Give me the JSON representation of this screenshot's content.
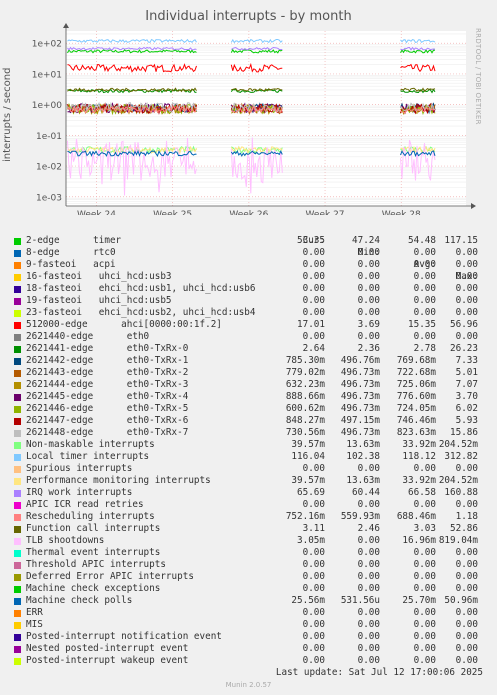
{
  "title": "Individual interrupts - by month",
  "side_credit": "RRDTOOL / TOBI OETIKER",
  "last_update": "Last update: Sat Jul 12 17:00:06 2025",
  "version": "Munin 2.0.57",
  "legend_header": {
    "cur": "Cur:",
    "min": "Min:",
    "avg": "Avg:",
    "max": "Max:"
  },
  "chart_data": {
    "type": "line",
    "ylabel": "interrupts / second",
    "yscale": "log",
    "ylim": [
      0.0005,
      250
    ],
    "y_ticks": [
      {
        "value": 100,
        "label": "1e+02"
      },
      {
        "value": 10,
        "label": "1e+01"
      },
      {
        "value": 1,
        "label": "1e+00"
      },
      {
        "value": 0.1,
        "label": "1e-01"
      },
      {
        "value": 0.01,
        "label": "1e-02"
      },
      {
        "value": 0.001,
        "label": "1e-03"
      }
    ],
    "x_ticks": [
      {
        "value": 24,
        "label": "Week 24"
      },
      {
        "value": 25,
        "label": "Week 25"
      },
      {
        "value": 26,
        "label": "Week 26"
      },
      {
        "value": 27,
        "label": "Week 27"
      },
      {
        "value": 28,
        "label": "Week 28"
      }
    ],
    "xlim": [
      23.6,
      28.85
    ],
    "data_segments": [
      [
        23.62,
        25.33
      ],
      [
        25.77,
        26.44
      ],
      [
        27.99,
        28.46
      ]
    ],
    "grid": true,
    "series": [
      {
        "name": "2-edge      timer",
        "color": "#00cc00",
        "cur": "53.35",
        "min": "47.24",
        "avg": "54.48",
        "max": "117.15",
        "level": 54.48,
        "jitter": 0.05
      },
      {
        "name": "8-edge      rtc0",
        "color": "#0066b3",
        "cur": "0.00",
        "min": "0.00",
        "avg": "0.00",
        "max": "0.00"
      },
      {
        "name": "9-fasteoi   acpi",
        "color": "#ff8000",
        "cur": "0.00",
        "min": "0.00",
        "avg": "0.00",
        "max": "0.00"
      },
      {
        "name": "16-fasteoi   uhci_hcd:usb3",
        "color": "#ffcc00",
        "cur": "0.00",
        "min": "0.00",
        "avg": "0.00",
        "max": "0.00"
      },
      {
        "name": "18-fasteoi   ehci_hcd:usb1, uhci_hcd:usb6",
        "color": "#330099",
        "cur": "0.00",
        "min": "0.00",
        "avg": "0.00",
        "max": "0.00"
      },
      {
        "name": "19-fasteoi   uhci_hcd:usb5",
        "color": "#990099",
        "cur": "0.00",
        "min": "0.00",
        "avg": "0.00",
        "max": "0.00"
      },
      {
        "name": "23-fasteoi   ehci_hcd:usb2, uhci_hcd:usb4",
        "color": "#ccff00",
        "cur": "0.00",
        "min": "0.00",
        "avg": "0.00",
        "max": "0.00"
      },
      {
        "name": "512000-edge      ahci[0000:00:1f.2]",
        "color": "#ff0000",
        "cur": "17.01",
        "min": "3.69",
        "avg": "15.35",
        "max": "56.96",
        "level": 15.35,
        "jitter": 0.12
      },
      {
        "name": "2621440-edge      eth0",
        "color": "#808080",
        "cur": "0.00",
        "min": "0.00",
        "avg": "0.00",
        "max": "0.00"
      },
      {
        "name": "2621441-edge      eth0-TxRx-0",
        "color": "#008f00",
        "cur": "2.64",
        "min": "2.36",
        "avg": "2.78",
        "max": "26.23",
        "level": 2.78,
        "jitter": 0.05
      },
      {
        "name": "2621442-edge      eth0-TxRx-1",
        "color": "#00487d",
        "cur": "785.30m",
        "min": "496.76m",
        "avg": "769.68m",
        "max": "7.33",
        "level": 0.7697,
        "jitter": 0.15
      },
      {
        "name": "2621443-edge      eth0-TxRx-2",
        "color": "#b35a00",
        "cur": "779.02m",
        "min": "496.73m",
        "avg": "722.68m",
        "max": "5.01",
        "level": 0.7227,
        "jitter": 0.15
      },
      {
        "name": "2621444-edge      eth0-TxRx-3",
        "color": "#b38f00",
        "cur": "632.23m",
        "min": "496.73m",
        "avg": "725.06m",
        "max": "7.07",
        "level": 0.7251,
        "jitter": 0.15
      },
      {
        "name": "2621445-edge      eth0-TxRx-4",
        "color": "#6b006b",
        "cur": "888.66m",
        "min": "496.73m",
        "avg": "776.60m",
        "max": "3.70",
        "level": 0.7766,
        "jitter": 0.15
      },
      {
        "name": "2621446-edge      eth0-TxRx-5",
        "color": "#8fb300",
        "cur": "600.62m",
        "min": "496.73m",
        "avg": "724.05m",
        "max": "6.02",
        "level": 0.7241,
        "jitter": 0.15
      },
      {
        "name": "2621447-edge      eth0-TxRx-6",
        "color": "#b30000",
        "cur": "848.27m",
        "min": "497.15m",
        "avg": "746.46m",
        "max": "5.93",
        "level": 0.7465,
        "jitter": 0.15
      },
      {
        "name": "2621448-edge      eth0-TxRx-7",
        "color": "#bebebe",
        "cur": "730.56m",
        "min": "496.73m",
        "avg": "823.63m",
        "max": "15.86",
        "level": 0.8236,
        "jitter": 0.15
      },
      {
        "name": "Non-maskable interrupts",
        "color": "#80ff80",
        "cur": "39.57m",
        "min": "13.63m",
        "avg": "33.92m",
        "max": "204.52m",
        "level": 0.0339,
        "jitter": 0.1
      },
      {
        "name": "Local timer interrupts",
        "color": "#80c9ff",
        "cur": "116.04",
        "min": "102.38",
        "avg": "118.12",
        "max": "312.82",
        "level": 118.12,
        "jitter": 0.05
      },
      {
        "name": "Spurious interrupts",
        "color": "#ffc080",
        "cur": "0.00",
        "min": "0.00",
        "avg": "0.00",
        "max": "0.00"
      },
      {
        "name": "Performance monitoring interrupts",
        "color": "#ffe680",
        "cur": "39.57m",
        "min": "13.63m",
        "avg": "33.92m",
        "max": "204.52m",
        "level": 0.0339,
        "jitter": 0.1
      },
      {
        "name": "IRQ work interrupts",
        "color": "#aa80ff",
        "cur": "65.69",
        "min": "60.44",
        "avg": "66.58",
        "max": "160.88",
        "level": 66.58,
        "jitter": 0.04
      },
      {
        "name": "APIC ICR read retries",
        "color": "#ee00cc",
        "cur": "0.00",
        "min": "0.00",
        "avg": "0.00",
        "max": "0.00"
      },
      {
        "name": "Rescheduling interrupts",
        "color": "#ff8080",
        "cur": "752.16m",
        "min": "559.93m",
        "avg": "688.46m",
        "max": "1.18",
        "level": 0.6885,
        "jitter": 0.1
      },
      {
        "name": "Function call interrupts",
        "color": "#666600",
        "cur": "3.11",
        "min": "2.46",
        "avg": "3.03",
        "max": "52.86",
        "level": 3.03,
        "jitter": 0.05
      },
      {
        "name": "TLB shootdowns",
        "color": "#ffbfff",
        "cur": "3.05m",
        "min": "0.00",
        "avg": "16.96m",
        "max": "819.04m",
        "level": 0.01696,
        "jitter": 0.7
      },
      {
        "name": "Thermal event interrupts",
        "color": "#00ffcc",
        "cur": "0.00",
        "min": "0.00",
        "avg": "0.00",
        "max": "0.00"
      },
      {
        "name": "Threshold APIC interrupts",
        "color": "#cc6699",
        "cur": "0.00",
        "min": "0.00",
        "avg": "0.00",
        "max": "0.00"
      },
      {
        "name": "Deferred Error APIC interrupts",
        "color": "#999900",
        "cur": "0.00",
        "min": "0.00",
        "avg": "0.00",
        "max": "0.00"
      },
      {
        "name": "Machine check exceptions",
        "color": "#00cc00",
        "cur": "0.00",
        "min": "0.00",
        "avg": "0.00",
        "max": "0.00"
      },
      {
        "name": "Machine check polls",
        "color": "#0066b3",
        "cur": "25.56m",
        "min": "531.56u",
        "avg": "25.70m",
        "max": "50.96m",
        "level": 0.0257,
        "jitter": 0.08
      },
      {
        "name": "ERR",
        "color": "#ff8000",
        "cur": "0.00",
        "min": "0.00",
        "avg": "0.00",
        "max": "0.00"
      },
      {
        "name": "MIS",
        "color": "#ffcc00",
        "cur": "0.00",
        "min": "0.00",
        "avg": "0.00",
        "max": "0.00"
      },
      {
        "name": "Posted-interrupt notification event",
        "color": "#330099",
        "cur": "0.00",
        "min": "0.00",
        "avg": "0.00",
        "max": "0.00"
      },
      {
        "name": "Nested posted-interrupt event",
        "color": "#990099",
        "cur": "0.00",
        "min": "0.00",
        "avg": "0.00",
        "max": "0.00"
      },
      {
        "name": "Posted-interrupt wakeup event",
        "color": "#ccff00",
        "cur": "0.00",
        "min": "0.00",
        "avg": "0.00",
        "max": "0.00"
      }
    ]
  }
}
